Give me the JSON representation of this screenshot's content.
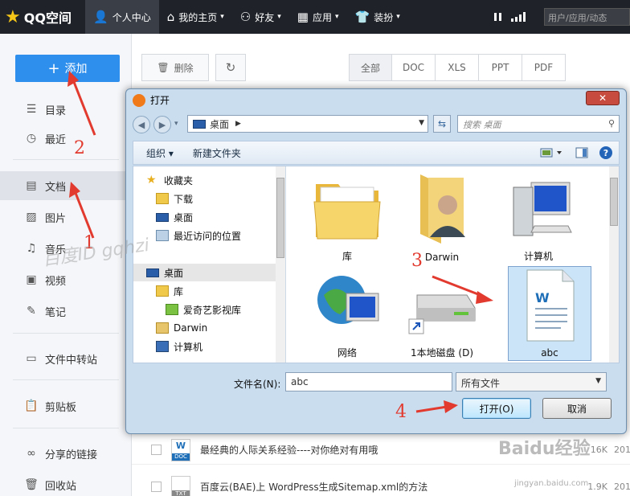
{
  "topbar": {
    "logo": "QQ空间",
    "items": [
      {
        "label": "个人中心",
        "icon": "user-icon",
        "active": true
      },
      {
        "label": "我的主页",
        "icon": "home-icon"
      },
      {
        "label": "好友",
        "icon": "friends-icon"
      },
      {
        "label": "应用",
        "icon": "apps-icon"
      },
      {
        "label": "装扮",
        "icon": "shirt-icon"
      }
    ],
    "search_placeholder": "用户/应用/动态"
  },
  "sidebar": {
    "add_label": "添加",
    "items": [
      {
        "label": "目录",
        "icon": "catalog-icon"
      },
      {
        "label": "最近",
        "icon": "clock-icon"
      },
      {
        "label": "文档",
        "icon": "document-icon",
        "active": true
      },
      {
        "label": "图片",
        "icon": "image-icon"
      },
      {
        "label": "音乐",
        "icon": "music-icon"
      },
      {
        "label": "视频",
        "icon": "video-icon"
      },
      {
        "label": "笔记",
        "icon": "note-icon"
      },
      {
        "label": "文件中转站",
        "icon": "transfer-icon"
      },
      {
        "label": "剪贴板",
        "icon": "clipboard-icon"
      },
      {
        "label": "分享的链接",
        "icon": "link-icon"
      },
      {
        "label": "回收站",
        "icon": "trash-icon"
      }
    ]
  },
  "toolbar": {
    "delete_label": "删除",
    "tabs": [
      "全部",
      "DOC",
      "XLS",
      "PPT",
      "PDF"
    ]
  },
  "file_list": [
    {
      "name": "最经典的人际关系经验----对你绝对有用哦",
      "type": "DOC",
      "size": "16K",
      "date": "201"
    },
    {
      "name": "百度云(BAE)上 WordPress生成Sitemap.xml的方法",
      "type": "TXT",
      "size": "1.9K",
      "date": "201"
    }
  ],
  "dialog": {
    "title": "打开",
    "close_label": "✕",
    "address": "桌面",
    "search_placeholder": "搜索 桌面",
    "commands": {
      "organize": "组织 ▾",
      "new_folder": "新建文件夹"
    },
    "tree": [
      {
        "label": "收藏夹",
        "icon": "star-icon"
      },
      {
        "label": "下载",
        "icon": "download-folder-icon"
      },
      {
        "label": "桌面",
        "icon": "desktop-icon"
      },
      {
        "label": "最近访问的位置",
        "icon": "recent-places-icon"
      },
      {
        "label": "桌面",
        "icon": "desktop-icon",
        "selected": true
      },
      {
        "label": "库",
        "icon": "library-icon"
      },
      {
        "label": "爱奇艺影视库",
        "icon": "iqiyi-icon"
      },
      {
        "label": "Darwin",
        "icon": "user-folder-icon"
      },
      {
        "label": "计算机",
        "icon": "computer-icon"
      }
    ],
    "files": [
      {
        "label": "库",
        "icon": "library-folder-icon"
      },
      {
        "label": "Darwin",
        "icon": "user-folder-icon"
      },
      {
        "label": "计算机",
        "icon": "computer-icon"
      },
      {
        "label": "网络",
        "icon": "network-icon"
      },
      {
        "label": "1本地磁盘 (D)",
        "icon": "disk-icon"
      },
      {
        "label": "abc",
        "icon": "word-document-icon",
        "selected": true
      }
    ],
    "filename_label": "文件名(N):",
    "filename_value": "abc",
    "filetype_value": "所有文件",
    "open_label": "打开(O)",
    "cancel_label": "取消"
  },
  "annotations": [
    "1",
    "2",
    "3",
    "4"
  ],
  "watermarks": [
    "百度ID gqhzi",
    "Baidu经验",
    "jingyan.baidu.com"
  ],
  "colors": {
    "accent": "#2f8fec",
    "topbar": "#1f2329",
    "annotation": "#e23a2e"
  }
}
